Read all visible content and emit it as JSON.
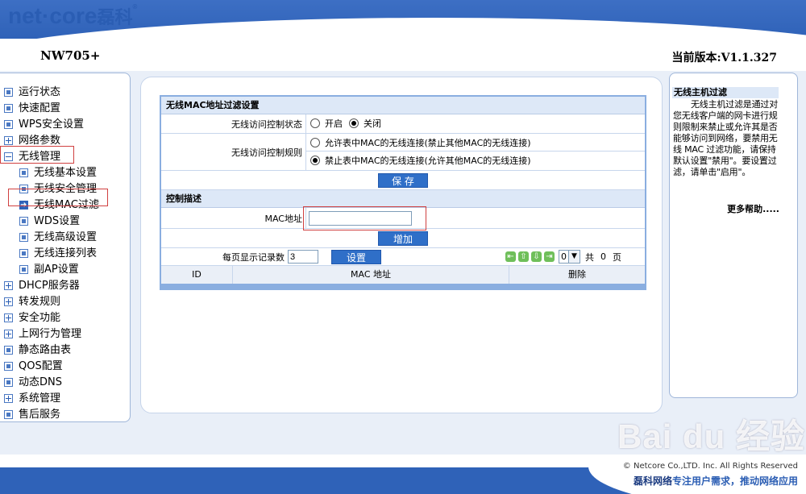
{
  "header": {
    "logo_text": "net·core",
    "logo_cn": "磊科",
    "logo_mark": "®",
    "model": "NW705+",
    "version": "当前版本:V1.1.327"
  },
  "sidebar": {
    "items": [
      {
        "label": "运行状态",
        "icon": "dot"
      },
      {
        "label": "快速配置",
        "icon": "dot"
      },
      {
        "label": "WPS安全设置",
        "icon": "dot"
      },
      {
        "label": "网络参数",
        "icon": "plus"
      },
      {
        "label": "无线管理",
        "icon": "minus"
      },
      {
        "label": "无线基本设置",
        "icon": "dot"
      },
      {
        "label": "无线安全管理",
        "icon": "dot"
      },
      {
        "label": "无线MAC过滤",
        "icon": "arrow"
      },
      {
        "label": "WDS设置",
        "icon": "dot"
      },
      {
        "label": "无线高级设置",
        "icon": "dot"
      },
      {
        "label": "无线连接列表",
        "icon": "dot"
      },
      {
        "label": "副AP设置",
        "icon": "dot"
      },
      {
        "label": "DHCP服务器",
        "icon": "plus"
      },
      {
        "label": "转发规则",
        "icon": "plus"
      },
      {
        "label": "安全功能",
        "icon": "plus"
      },
      {
        "label": "上网行为管理",
        "icon": "plus"
      },
      {
        "label": "静态路由表",
        "icon": "dot"
      },
      {
        "label": "QOS配置",
        "icon": "dot"
      },
      {
        "label": "动态DNS",
        "icon": "dot"
      },
      {
        "label": "系统管理",
        "icon": "plus"
      },
      {
        "label": "售后服务",
        "icon": "dot"
      }
    ]
  },
  "form": {
    "section1_title": "无线MAC地址过滤设置",
    "access_state_label": "无线访问控制状态",
    "state_on": "开启",
    "state_off": "关闭",
    "rule_label": "无线访问控制规则",
    "rule_allow": "允许表中MAC的无线连接(禁止其他MAC的无线连接)",
    "rule_deny": "禁止表中MAC的无线连接(允许其他MAC的无线连接)",
    "save_button": "保 存",
    "section2_title": "控制描述",
    "mac_label": "MAC地址",
    "mac_value": "",
    "add_button": "增加",
    "per_page_label": "每页显示记录数",
    "per_page_value": "3",
    "set_button": "设置",
    "page_select": "0",
    "total_prefix": "共",
    "total_pages": "0",
    "total_suffix": "页",
    "col_id": "ID",
    "col_mac": "MAC 地址",
    "col_delete": "删除"
  },
  "help": {
    "title": "无线主机过滤",
    "body": "无线主机过滤是通过对您无线客户端的网卡进行规则限制来禁止或允许其是否能够访问到网络，要禁用无线 MAC 过滤功能，请保持默认设置\"禁用\"。要设置过滤，请单击\"启用\"。",
    "more": "更多帮助....."
  },
  "footer": {
    "copyright": "© Netcore Co.,LTD. Inc. All Rights Reserved",
    "slogan_a": "磊科网络",
    "slogan_b": "专注用户需求，推动网络应用"
  },
  "watermark": "Bai du 经验",
  "colors": {
    "brand_blue": "#2f62b8",
    "button_blue": "#2f6fc8",
    "highlight_red": "#d04040"
  }
}
